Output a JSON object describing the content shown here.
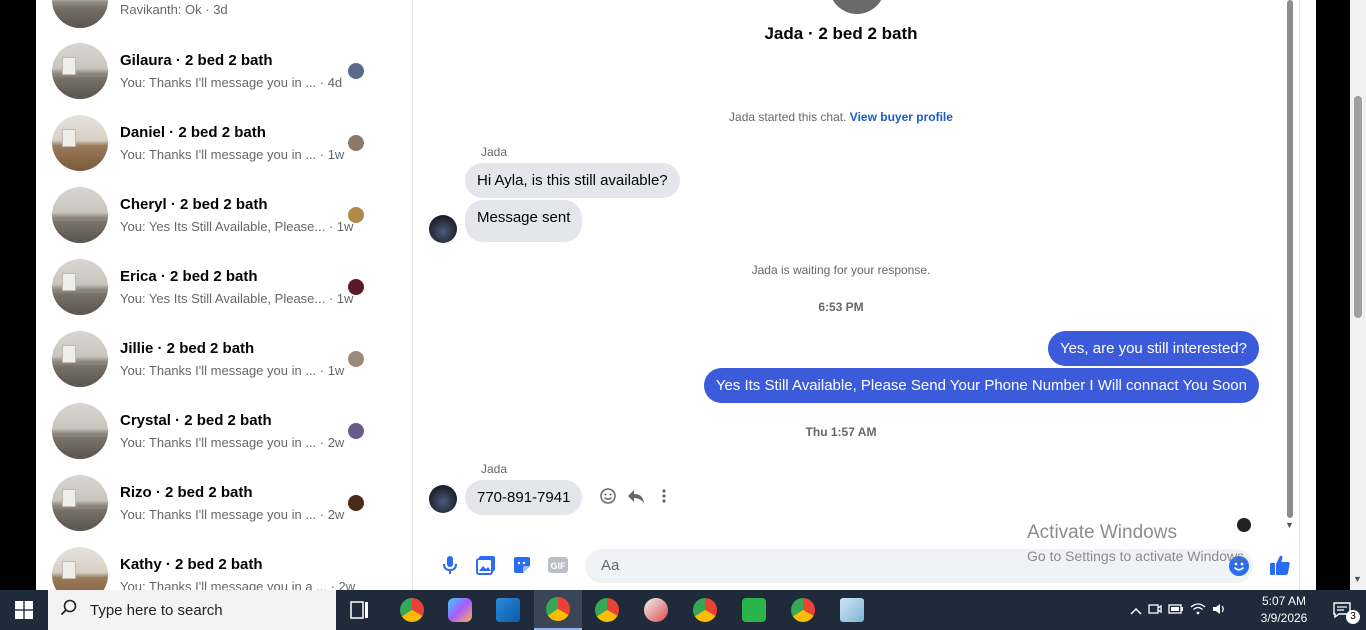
{
  "conversations": [
    {
      "title": "",
      "preview": "Ravikanth: Ok · 3d",
      "avatar_color": "#ffffff"
    },
    {
      "title": "Gilaura · 2 bed 2 bath",
      "preview": "You: Thanks I'll message you in ... · 4d",
      "avatar_color": "#5a6b8a"
    },
    {
      "title": "Daniel · 2 bed 2 bath",
      "preview": "You: Thanks I'll message you in ... · 1w",
      "avatar_color": "#8b7a6a"
    },
    {
      "title": "Cheryl · 2 bed 2 bath",
      "preview": "You: Yes Its Still Available, Please... · 1w",
      "avatar_color": "#b08a4a"
    },
    {
      "title": "Erica · 2 bed 2 bath",
      "preview": "You: Yes Its Still Available, Please... · 1w",
      "avatar_color": "#5a1a2a"
    },
    {
      "title": "Jillie · 2 bed 2 bath",
      "preview": "You: Thanks I'll message you in ... · 1w",
      "avatar_color": "#9a8a7a"
    },
    {
      "title": "Crystal · 2 bed 2 bath",
      "preview": "You: Thanks I'll message you in ... · 2w",
      "avatar_color": "#6a5a8a"
    },
    {
      "title": "Rizo · 2 bed 2 bath",
      "preview": "You: Thanks I'll message you in ... · 2w",
      "avatar_color": "#4a2a1a"
    },
    {
      "title": "Kathy · 2 bed 2 bath",
      "preview": "You: Thanks I'll message you in a ... · 2w",
      "avatar_color": "#ffffff"
    }
  ],
  "chat": {
    "title": "Jada · 2 bed 2 bath",
    "started_text": "Jada started this chat.",
    "view_profile": "View buyer profile",
    "sender_name": "Jada",
    "msg1": "Hi Ayla, is this still available?",
    "msg2": "Message sent",
    "waiting": "Jada is waiting for your response.",
    "time1": "6:53 PM",
    "out1": "Yes, are you still interested?",
    "out2": "Yes Its Still Available, Please Send Your Phone Number I Will connact You Soon",
    "time2": "Thu 1:57 AM",
    "msg3": "770-891-7941",
    "composer_placeholder": "Aa"
  },
  "watermark": {
    "line1": "Activate Windows",
    "line2": "Go to Settings to activate Windows."
  },
  "taskbar": {
    "search_placeholder": "Type here to search",
    "time": "5:07 AM",
    "date": "3/9/2026",
    "notification_count": "3"
  }
}
